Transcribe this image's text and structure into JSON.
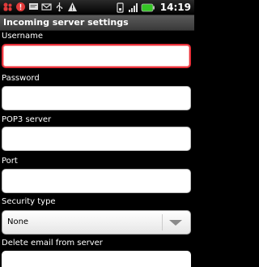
{
  "status_bar": {
    "time": "14:19",
    "icons": [
      "people-icon",
      "alert-icon",
      "sms-icon",
      "email-icon",
      "usb-icon",
      "warning-icon",
      "wifi-signal-icon",
      "signal-icon",
      "battery-icon"
    ],
    "accent_red": "#e6303a",
    "battery_color": "#34c524"
  },
  "screen": {
    "title": "Incoming server settings",
    "fields": [
      {
        "label": "Username",
        "value": "",
        "focused": true
      },
      {
        "label": "Password",
        "value": ""
      },
      {
        "label": "POP3 server",
        "value": ""
      },
      {
        "label": "Port",
        "value": ""
      }
    ],
    "security_type": {
      "label": "Security type",
      "value": "None"
    },
    "delete_email": {
      "label": "Delete email from server"
    }
  }
}
